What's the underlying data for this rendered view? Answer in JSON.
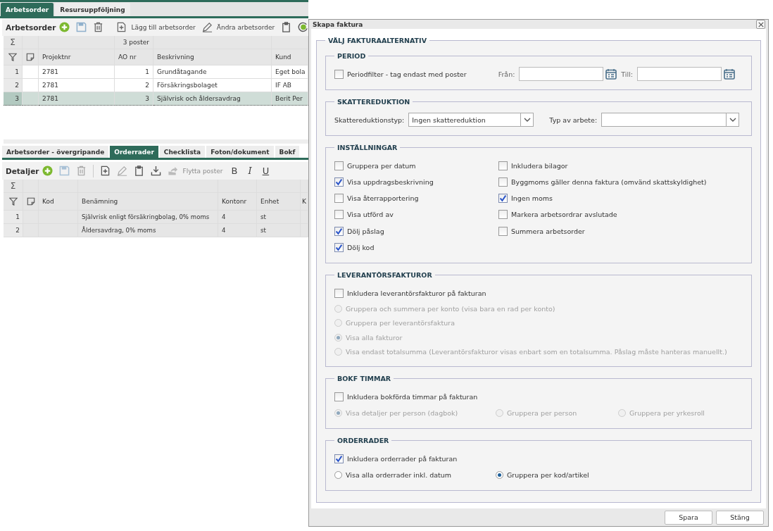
{
  "main_tabs": [
    {
      "label": "Arbetsorder",
      "selected": true
    },
    {
      "label": "Resursuppföljning",
      "selected": false
    }
  ],
  "work_orders": {
    "title": "Arbetsorder",
    "actions": [
      {
        "label": "Lägg till arbetsorder",
        "kind": "add-doc"
      },
      {
        "label": "Ändra arbetsorder",
        "kind": "edit"
      }
    ],
    "grid": {
      "sum_symbol": "Σ",
      "count": "3 poster",
      "columns": [
        "Projektnr",
        "AO nr",
        "Beskrivning",
        "Kund"
      ],
      "rows": [
        {
          "number": "1",
          "cells": [
            "2781",
            "1",
            "Grundåtagande",
            "Eget bola"
          ],
          "selected": false
        },
        {
          "number": "2",
          "cells": [
            "2781",
            "2",
            "Försäkringsbolaget",
            "IF AB"
          ],
          "selected": false
        },
        {
          "number": "3",
          "cells": [
            "2781",
            "3",
            "Självrisk och åldersavdrag",
            "Berit Per"
          ],
          "selected": true
        }
      ]
    }
  },
  "detail_tabs": [
    {
      "label": "Arbetsorder - övergripande",
      "selected": false
    },
    {
      "label": "Orderrader",
      "selected": true
    },
    {
      "label": "Checklista",
      "selected": false
    },
    {
      "label": "Foton/dokument",
      "selected": false
    },
    {
      "label": "Bokf",
      "selected": false
    }
  ],
  "details": {
    "title": "Detaljer",
    "move_action": {
      "label": "Flytta poster",
      "disabled": true
    },
    "format_buttons": [
      "B",
      "I",
      "U"
    ],
    "grid": {
      "sum_symbol": "Σ",
      "columns": [
        "Kod",
        "Benämning",
        "Kontonr",
        "Enhet",
        "K"
      ],
      "rows": [
        {
          "number": "1",
          "cells": [
            "",
            "Självrisk enligt försäkringbolag, 0% moms",
            "4",
            "st"
          ]
        },
        {
          "number": "2",
          "cells": [
            "",
            "Åldersavdrag, 0% moms",
            "4",
            "st"
          ]
        }
      ]
    }
  },
  "dialog": {
    "title": "Skapa faktura",
    "legend": "VÄLJ FAKTURAALTERNATIV",
    "period": {
      "legend": "PERIOD",
      "filter": {
        "label": "Periodfilter - tag endast med poster",
        "checked": false
      },
      "from_label": "Från:",
      "to_label": "Till:"
    },
    "tax": {
      "legend": "SKATTEREDUKTION",
      "type_label": "Skattereduktionstyp:",
      "type_value": "Ingen skattereduktion",
      "work_label": "Typ av arbete:"
    },
    "settings": {
      "legend": "INSTÄLLNINGAR",
      "left": [
        {
          "label": "Gruppera per datum",
          "checked": false
        },
        {
          "label": "Visa uppdragsbeskrivning",
          "checked": true
        },
        {
          "label": "Visa återrapportering",
          "checked": false
        },
        {
          "label": "Visa utförd av",
          "checked": false
        },
        {
          "label": "Dölj påslag",
          "checked": true
        },
        {
          "label": "Dölj kod",
          "checked": true
        }
      ],
      "right": [
        {
          "label": "Inkludera bilagor",
          "checked": false
        },
        {
          "label": "Byggmoms gäller denna faktura (omvänd skattskyldighet)",
          "checked": false
        },
        {
          "label": "Ingen moms",
          "checked": true
        },
        {
          "label": "Markera arbetsordrar avslutade",
          "checked": false
        },
        {
          "label": "Summera arbetsorder",
          "checked": false
        }
      ]
    },
    "supplier": {
      "legend": "LEVERANTÖRSFAKTUROR",
      "include": {
        "label": "Inkludera leverantörsfakturor på fakturan",
        "checked": false
      },
      "options": [
        {
          "label": "Gruppera och summera per konto (visa bara en rad per konto)",
          "selected": false,
          "disabled": true
        },
        {
          "label": "Gruppera per leverantörsfaktura",
          "selected": false,
          "disabled": true
        },
        {
          "label": "Visa alla fakturor",
          "selected": true,
          "disabled": true
        },
        {
          "label": "Visa endast totalsumma (Leverantörsfakturor visas enbart som en totalsumma. Påslag måste hanteras manuellt.)",
          "selected": false,
          "disabled": true
        }
      ]
    },
    "hours": {
      "legend": "BOKF TIMMAR",
      "include": {
        "label": "Inkludera bokförda timmar på fakturan",
        "checked": false
      },
      "options": [
        {
          "label": "Visa detaljer per person (dagbok)",
          "selected": true,
          "disabled": true
        },
        {
          "label": "Gruppera per person",
          "selected": false,
          "disabled": true
        },
        {
          "label": "Gruppera per yrkesroll",
          "selected": false,
          "disabled": true
        }
      ]
    },
    "order_rows": {
      "legend": "ORDERRADER",
      "include": {
        "label": "Inkludera orderrader på fakturan",
        "checked": true
      },
      "options": [
        {
          "label": "Visa alla orderrader inkl. datum",
          "selected": false,
          "disabled": false
        },
        {
          "label": "Gruppera per kod/artikel",
          "selected": true,
          "disabled": false
        }
      ]
    },
    "buttons": [
      "Spara",
      "Stäng"
    ]
  }
}
